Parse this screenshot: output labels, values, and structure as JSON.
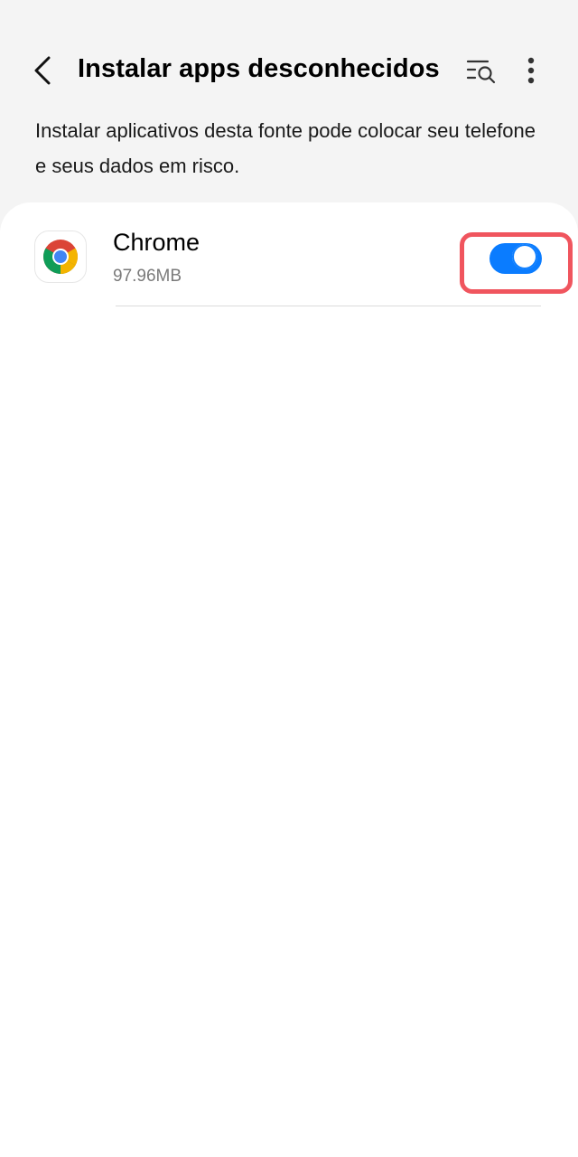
{
  "header": {
    "title": "Instalar apps desconhecidos",
    "back_icon": "chevron-left-icon",
    "search_icon": "list-search-icon",
    "more_icon": "more-vertical-icon"
  },
  "description": "Instalar aplicativos desta fonte pode colocar seu telefone e seus dados em risco.",
  "apps": [
    {
      "name": "Chrome",
      "size": "97.96MB",
      "icon": "chrome-icon",
      "allowed": true
    }
  ],
  "colors": {
    "accent": "#0a7cff",
    "highlight": "#f0555e",
    "background": "#f4f4f4",
    "card": "#ffffff"
  }
}
